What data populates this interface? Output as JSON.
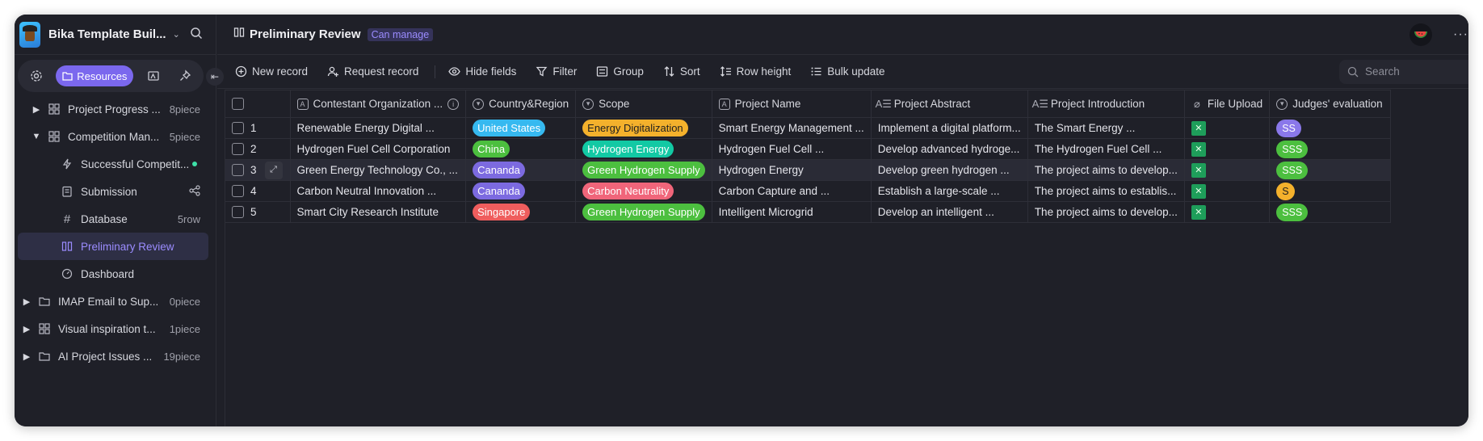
{
  "sidebar": {
    "app_title": "Bika Template Buil...",
    "tabs": {
      "resources_label": "Resources"
    },
    "items": [
      {
        "label": "Project Progress ...",
        "meta": "8piece",
        "icon": "grid-icon",
        "arrow": "▶"
      },
      {
        "label": "Competition Man...",
        "meta": "5piece",
        "icon": "grid-icon",
        "arrow": "▼"
      },
      {
        "label": "Successful Competit...",
        "meta": "",
        "icon": "bolt-icon"
      },
      {
        "label": "Submission",
        "meta": "",
        "icon": "form-icon"
      },
      {
        "label": "Database",
        "meta": "5row",
        "icon": "hash-icon"
      },
      {
        "label": "Preliminary Review",
        "meta": "",
        "icon": "kanban-icon"
      },
      {
        "label": "Dashboard",
        "meta": "",
        "icon": "gauge-icon"
      },
      {
        "label": "IMAP Email to Sup...",
        "meta": "0piece",
        "icon": "folder-icon",
        "arrow": "▶"
      },
      {
        "label": "Visual inspiration t...",
        "meta": "1piece",
        "icon": "grid-icon",
        "arrow": "▶"
      },
      {
        "label": "AI Project Issues ...",
        "meta": "19piece",
        "icon": "folder-icon",
        "arrow": "▶"
      }
    ]
  },
  "header": {
    "title": "Preliminary Review",
    "permission": "Can manage",
    "more": "···"
  },
  "toolbar": {
    "new_record": "New record",
    "request_record": "Request record",
    "hide_fields": "Hide fields",
    "filter": "Filter",
    "group": "Group",
    "sort": "Sort",
    "row_height": "Row height",
    "bulk_update": "Bulk update",
    "search_placeholder": "Search"
  },
  "table": {
    "columns": [
      "Contestant Organization ...",
      "Country&Region",
      "Scope",
      "Project Name",
      "Project Abstract",
      "Project Introduction",
      "File Upload",
      "Judges' evaluation"
    ],
    "rows": [
      {
        "no": "1",
        "org": "Renewable Energy Digital ...",
        "country": "United States",
        "scope": "Energy Digitalization",
        "name": "Smart Energy Management ...",
        "abstract": "Implement a digital platform...",
        "intro": "The Smart Energy ...",
        "eval": "SS"
      },
      {
        "no": "2",
        "org": "Hydrogen Fuel Cell Corporation",
        "country": "China",
        "scope": "Hydrogen Energy",
        "name": "Hydrogen Fuel Cell ...",
        "abstract": "Develop advanced hydroge...",
        "intro": "The Hydrogen Fuel Cell ...",
        "eval": "SSS"
      },
      {
        "no": "3",
        "org": "Green Energy Technology Co., ...",
        "country": "Cananda",
        "scope": "Green Hydrogen Supply",
        "name": "Hydrogen Energy",
        "abstract": "Develop green hydrogen ...",
        "intro": "The project aims to develop...",
        "eval": "SSS"
      },
      {
        "no": "4",
        "org": "Carbon Neutral Innovation ...",
        "country": "Cananda",
        "scope": "Carbon Neutrality",
        "name": "Carbon Capture and ...",
        "abstract": "Establish a large-scale ...",
        "intro": "The project aims to establis...",
        "eval": "S"
      },
      {
        "no": "5",
        "org": "Smart City Research Institute",
        "country": "Singapore",
        "scope": "Green Hydrogen Supply",
        "name": "Intelligent Microgrid",
        "abstract": "Develop an intelligent ...",
        "intro": "The project aims to develop...",
        "eval": "SSS"
      }
    ]
  },
  "colors": {
    "accent": "#7b68ee",
    "country_united_states": "#36b9f0",
    "country_china": "#4cbf3f",
    "country_cananda": "#7c6ae0",
    "country_singapore": "#ef5d5d",
    "scope_energy_digitalization": "#f4b12c",
    "scope_hydrogen_energy": "#12c9a4",
    "scope_green_hydrogen_supply": "#4cbf3f",
    "scope_carbon_neutrality": "#f0657a",
    "eval_ss": "#8a78ea",
    "eval_sss": "#4cbf3f",
    "eval_s": "#f4b12c"
  }
}
